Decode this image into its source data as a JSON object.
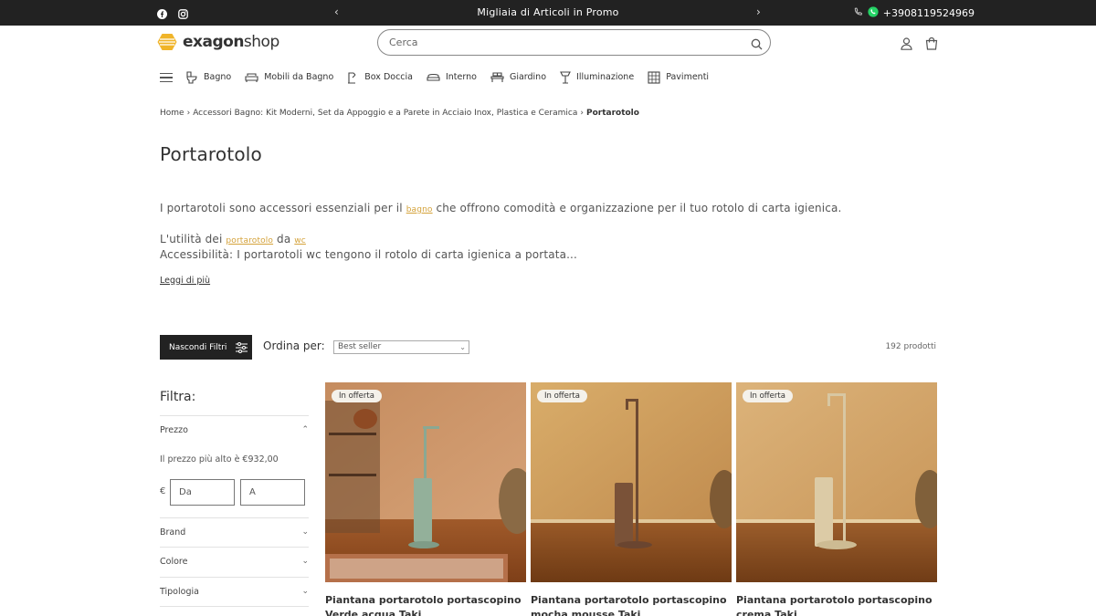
{
  "announcement": {
    "promo_text": "Migliaia di Articoli in Promo",
    "phone": "+3908119524969",
    "prev_arrow": "‹",
    "next_arrow": "›",
    "social_icons": [
      "facebook-icon",
      "instagram-icon"
    ]
  },
  "header": {
    "logo_text_bold": "exagon",
    "logo_text_regular": "shop",
    "search_placeholder": "Cerca",
    "icons": [
      "account-icon",
      "cart-icon"
    ]
  },
  "nav": {
    "items": [
      {
        "label": "Bagno",
        "icon": "toilet-icon"
      },
      {
        "label": "Mobili da Bagno",
        "icon": "sofa-icon"
      },
      {
        "label": "Box Doccia",
        "icon": "shower-icon"
      },
      {
        "label": "Interno",
        "icon": "armchair-icon"
      },
      {
        "label": "Giardino",
        "icon": "bench-icon"
      },
      {
        "label": "Illuminazione",
        "icon": "lamp-icon"
      },
      {
        "label": "Pavimenti",
        "icon": "tiles-icon"
      }
    ]
  },
  "breadcrumb": {
    "home": "Home",
    "category": "Accessori Bagno: Kit Moderni, Set da Appoggio e a Parete in Acciaio Inox, Plastica e Ceramica",
    "current": "Portarotolo",
    "separator": "›"
  },
  "page": {
    "title": "Portarotolo",
    "desc1_before": "I portarotoli sono accessori essenziali per il ",
    "desc1_link": "bagno",
    "desc1_after": " che offrono comodità e organizzazione per il tuo rotolo di carta igienica.",
    "desc2_before": "L'utilità dei ",
    "desc2_link1": "portarotolo",
    "desc2_mid": " da ",
    "desc2_link2": "wc",
    "desc3": "Accessibilità: I portarotoli wc tengono il rotolo di carta igienica a portata...",
    "read_more": "Leggi di più"
  },
  "toolbar": {
    "filter_button": "Nascondi Filtri",
    "sort_label": "Ordina per:",
    "sort_value": "Best seller",
    "product_count": "192 prodotti"
  },
  "filters": {
    "title": "Filtra:",
    "price_label": "Prezzo",
    "price_hint": "Il prezzo più alto è €932,00",
    "currency": "€",
    "from_placeholder": "Da",
    "to_placeholder": "A",
    "sections": [
      "Brand",
      "Colore",
      "Tipologia"
    ]
  },
  "products": [
    {
      "badge": "In offerta",
      "title": "Piantana portarotolo portascopino Verde acqua Taki"
    },
    {
      "badge": "In offerta",
      "title": "Piantana portarotolo portascopino mocha mousse Taki"
    },
    {
      "badge": "In offerta",
      "title": "Piantana portarotolo portascopino crema Taki"
    }
  ],
  "colors": {
    "topbar_bg": "#222222",
    "accent_link": "#d4a23a",
    "whatsapp": "#25d366",
    "logo_yellow": "#f0b429"
  }
}
